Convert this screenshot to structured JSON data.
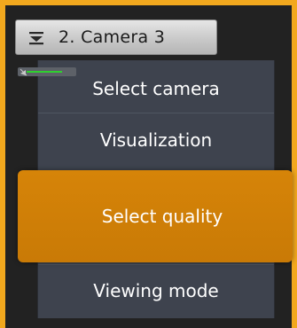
{
  "camera_button": {
    "label": "2. Camera 3",
    "icon": "hamburger-menu-icon"
  },
  "indicator": {
    "icon": "camera-mini-status-icon",
    "bar_color": "#2fd02f"
  },
  "menu": {
    "items": [
      {
        "label": "Select camera",
        "selected": false
      },
      {
        "label": "Visualization",
        "selected": false
      },
      {
        "label": "Select quality",
        "selected": true
      },
      {
        "label": "Viewing mode",
        "selected": false
      }
    ]
  },
  "colors": {
    "accent": "#f2a81e",
    "selected_item": "#d68408",
    "menu_background": "#3e434e",
    "button_background": "#d6d6d6"
  }
}
